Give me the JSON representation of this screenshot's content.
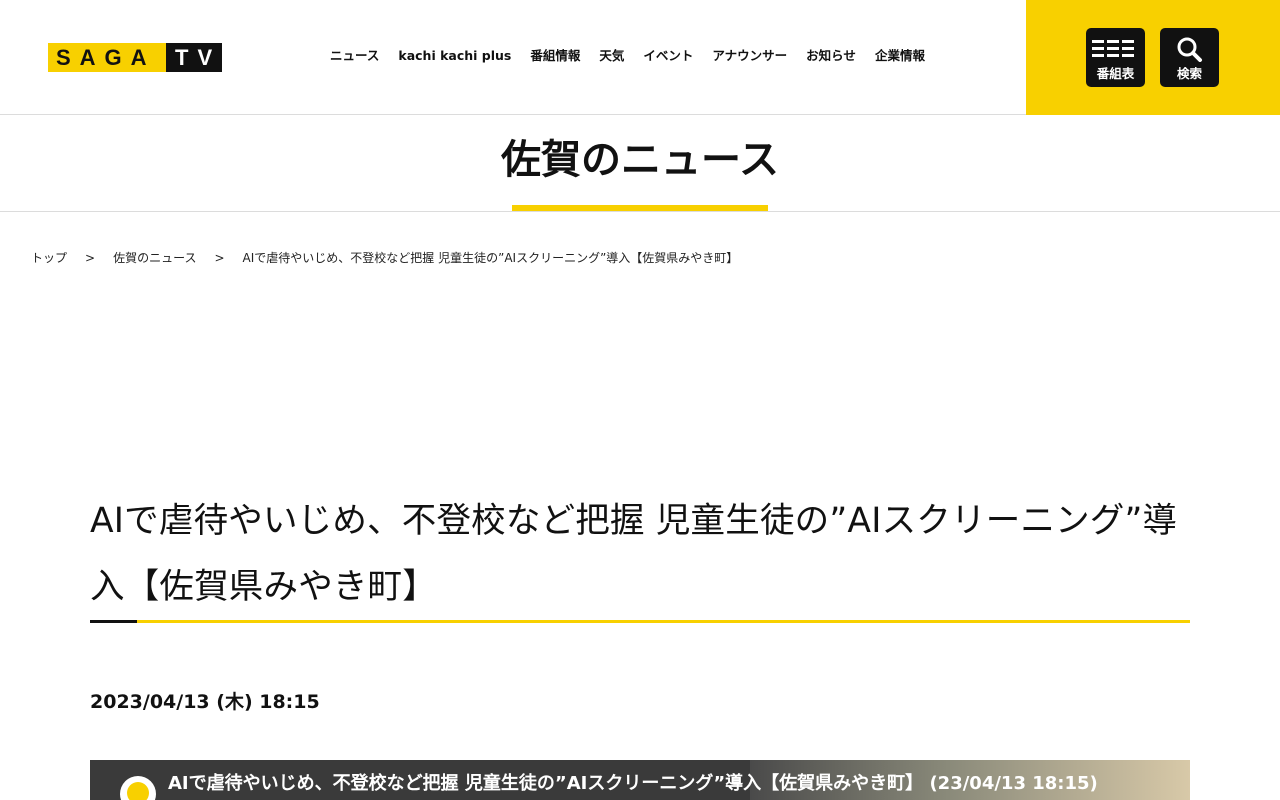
{
  "header": {
    "logo": {
      "saga": "SAGA",
      "tv": "TV"
    },
    "nav": [
      "ニュース",
      "kachi kachi plus",
      "番組情報",
      "天気",
      "イベント",
      "アナウンサー",
      "お知らせ",
      "企業情報"
    ],
    "program_button_label": "番組表",
    "search_button_label": "検索"
  },
  "section": {
    "title": "佐賀のニュース"
  },
  "breadcrumb": [
    "トップ",
    "佐賀のニュース",
    "AIで虐待やいじめ、不登校など把握 児童生徒の”AIスクリーニング”導入【佐賀県みやき町】"
  ],
  "breadcrumb_separator": ">",
  "article": {
    "title": "AIで虐待やいじめ、不登校など把握 児童生徒の”AIスクリーニング”導入【佐賀県みやき町】",
    "date": "2023/04/13 (木) 18:15"
  },
  "video": {
    "title": "AIで虐待やいじめ、不登校など把握 児童生徒の”AIスクリーニング”導入【佐賀県みやき町】 (23/04/13 18:15)"
  },
  "colors": {
    "brand_yellow": "#f8d000",
    "brand_black": "#111111"
  },
  "icons": {
    "program": "list-icon",
    "search": "search-icon"
  }
}
